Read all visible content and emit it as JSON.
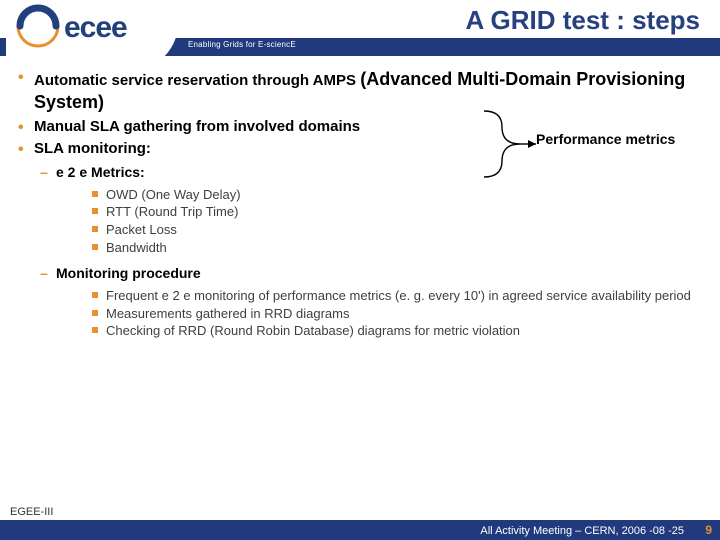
{
  "header": {
    "title": "A GRID test : steps",
    "tagline": "Enabling Grids for E-sciencE"
  },
  "bullets": {
    "b0_pre": "Automatic service reservation through AMPS ",
    "b0_strong": "(Advanced Multi-Domain Provisioning System)",
    "b1": "Manual SLA gathering from involved domains",
    "b2": "SLA monitoring:"
  },
  "e2e": {
    "heading": "e 2 e Metrics:",
    "m0": "OWD (One Way Delay)",
    "m1": "RTT (Round Trip Time)",
    "m2": "Packet Loss",
    "m3": "Bandwidth"
  },
  "mon": {
    "heading": "Monitoring procedure",
    "p0": "Frequent e 2 e monitoring of performance metrics (e. g. every 10') in agreed service availability period",
    "p1": "Measurements gathered in RRD diagrams",
    "p2": "Checking of RRD (Round Robin Database)  diagrams for metric violation"
  },
  "annotation": "Performance metrics",
  "footer": {
    "project": "EGEE-III",
    "venue": "All Activity Meeting – CERN, 2006 -08 -25",
    "page": "9"
  }
}
